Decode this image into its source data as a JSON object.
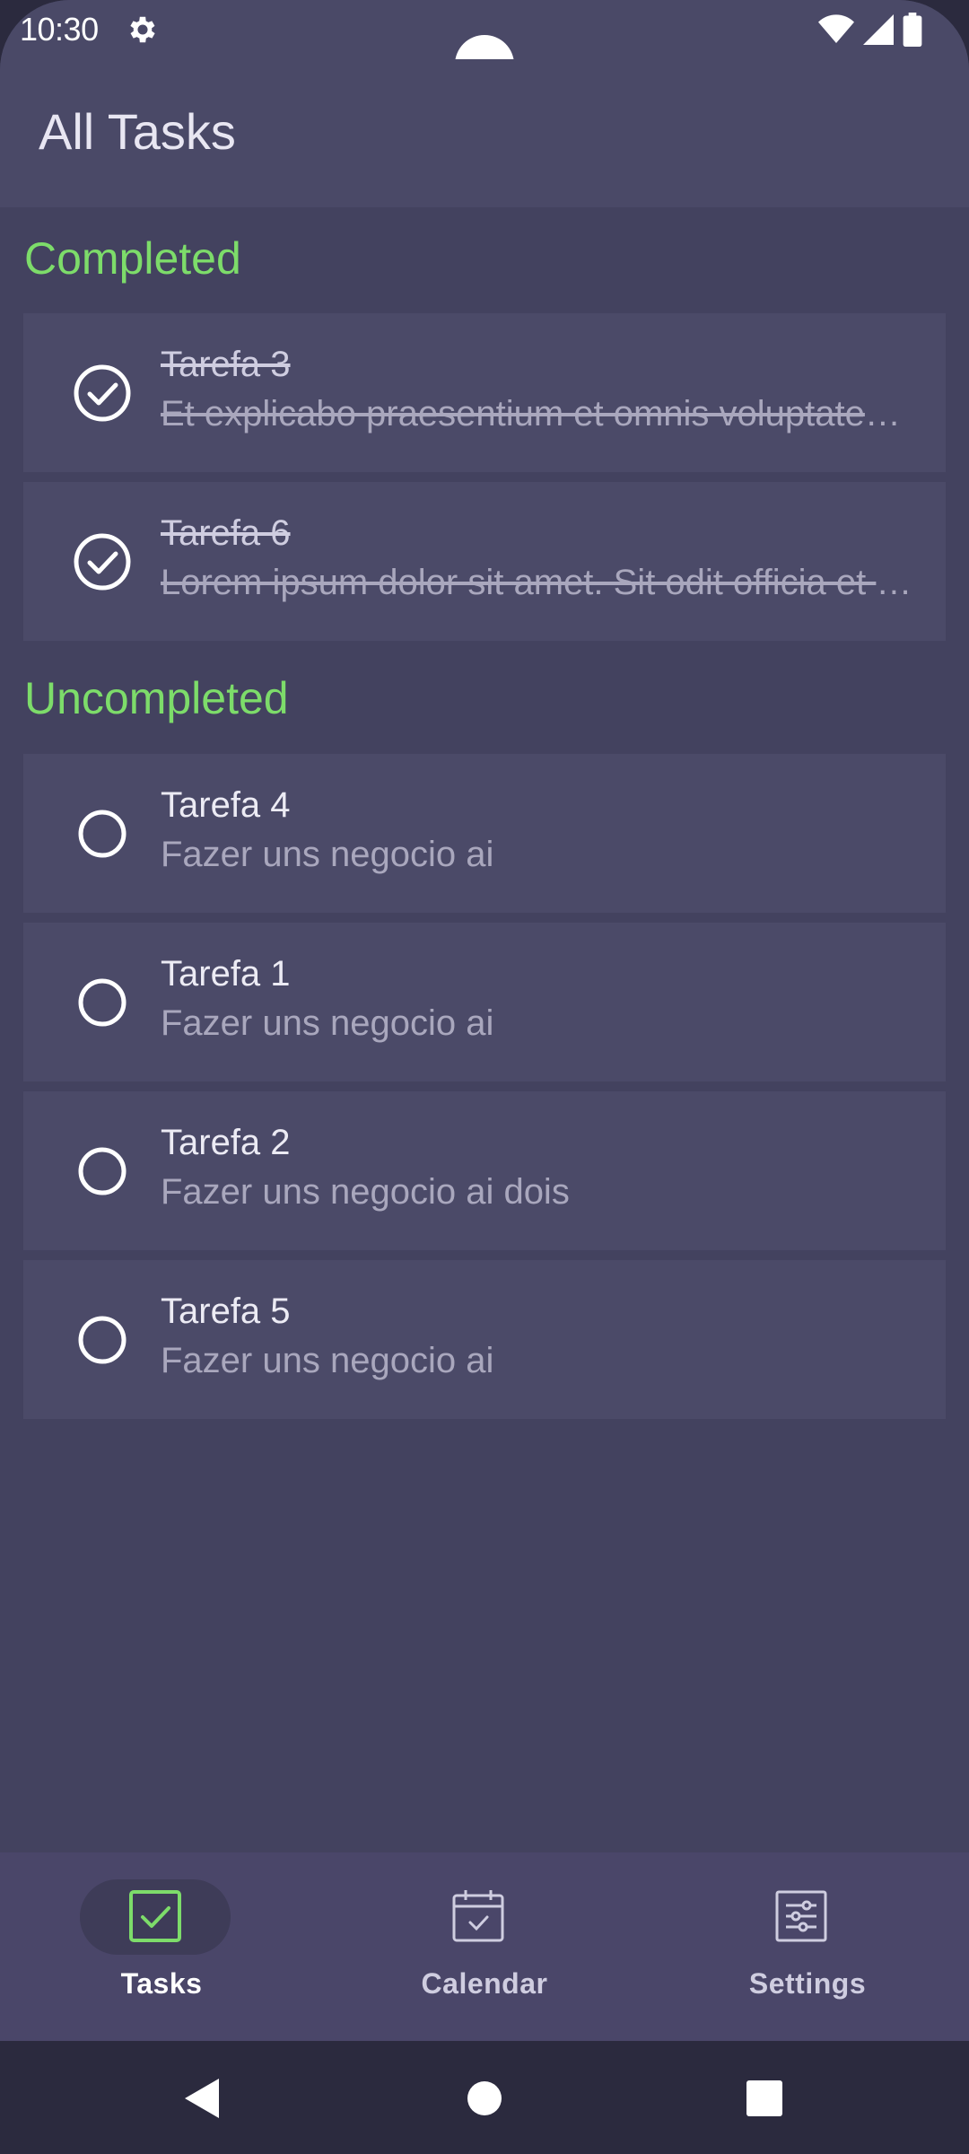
{
  "status_bar": {
    "time": "10:30"
  },
  "app_bar": {
    "title": "All Tasks"
  },
  "sections": {
    "completed_title": "Completed",
    "uncompleted_title": "Uncompleted"
  },
  "completed_tasks": [
    {
      "title": "Tarefa 3",
      "description": "Et explicabo praesentium et omnis voluptatem quos."
    },
    {
      "title": "Tarefa 6",
      "description": "Lorem ipsum dolor sit amet. Sit odit officia et quia."
    }
  ],
  "uncompleted_tasks": [
    {
      "title": "Tarefa 4",
      "description": "Fazer uns negocio ai"
    },
    {
      "title": "Tarefa 1",
      "description": "Fazer uns negocio ai"
    },
    {
      "title": "Tarefa 2",
      "description": "Fazer uns negocio ai dois"
    },
    {
      "title": "Tarefa 5",
      "description": "Fazer uns negocio ai"
    }
  ],
  "bottom_nav": {
    "items": [
      {
        "label": "Tasks",
        "icon": "checkbox-icon",
        "active": true
      },
      {
        "label": "Calendar",
        "icon": "calendar-icon",
        "active": false
      },
      {
        "label": "Settings",
        "icon": "sliders-icon",
        "active": false
      }
    ]
  },
  "colors": {
    "accent": "#7ddc6a",
    "background": "#43425f",
    "card": "#4b4a68",
    "app_bar": "#4a4967"
  }
}
